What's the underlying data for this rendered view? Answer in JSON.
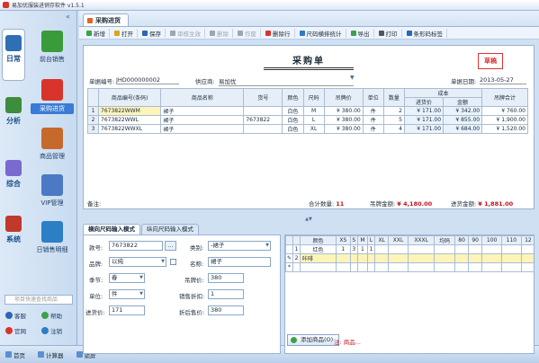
{
  "app": {
    "title": "易加优服装进销存软件 v1.5.1"
  },
  "sidebar": {
    "collapse_label": "«",
    "categories": [
      {
        "label": "日常",
        "color": "#2f6fb3"
      },
      {
        "label": "分析",
        "color": "#3c8d3c"
      },
      {
        "label": "综合",
        "color": "#7a6ad0"
      },
      {
        "label": "系统",
        "color": "#c0392b"
      }
    ],
    "modules": [
      {
        "label": "前台销售",
        "color": "#3a9b3a"
      },
      {
        "label": "采购进货",
        "color": "#d9342b"
      },
      {
        "label": "商品管理",
        "color": "#c56a2c"
      },
      {
        "label": "VIP管理",
        "color": "#4b79c4"
      },
      {
        "label": "日销售明细",
        "color": "#2c7ec5"
      }
    ],
    "search_placeholder": "项目快速查找商品",
    "links": [
      {
        "label": "客服",
        "color": "#2c66b8"
      },
      {
        "label": "帮助",
        "color": "#3aa24a"
      },
      {
        "label": "官网",
        "color": "#d9342b"
      },
      {
        "label": "注销",
        "color": "#2c7ec5"
      }
    ]
  },
  "statusbar": {
    "items": [
      "首页",
      "计算器",
      "锁屏"
    ]
  },
  "tab": {
    "label": "采购进货"
  },
  "toolbar": {
    "items": [
      {
        "label": "新增",
        "color": "#3aa24a",
        "dim": false
      },
      {
        "label": "打开",
        "color": "#e0a21c",
        "dim": false
      },
      {
        "label": "保存",
        "color": "#2c66b8",
        "dim": false
      },
      {
        "label": "审核生效",
        "color": "#9aa6b4",
        "dim": true
      },
      {
        "label": "删除",
        "color": "#9aa6b4",
        "dim": true
      },
      {
        "label": "作废",
        "color": "#9aa6b4",
        "dim": true
      },
      {
        "label": "删除行",
        "color": "#d9342b",
        "dim": false
      },
      {
        "label": "尺码横排统计",
        "color": "#2c7ec5",
        "dim": false
      },
      {
        "label": "导出",
        "color": "#3aa24a",
        "dim": false
      },
      {
        "label": "打印",
        "color": "#555555",
        "dim": false
      },
      {
        "label": "条形码标签",
        "color": "#2c66b8",
        "dim": false
      }
    ]
  },
  "form": {
    "title": "采购单",
    "stamp": "草稿",
    "order_no_label": "单据编号:",
    "order_no": "JHD000000002",
    "supplier_label": "供应商:",
    "supplier": "易加优",
    "date_label": "单据日期:",
    "date": "2013-05-27",
    "columns": [
      "商品编号(条码)",
      "商品名称",
      "货号",
      "颜色",
      "尺码",
      "吊牌价",
      "单位",
      "数量",
      "进货价",
      "金额",
      "吊牌合计"
    ],
    "cost_group_label": "成本",
    "rows": [
      {
        "idx": "1",
        "code": "7673822WWM",
        "name": "裙子",
        "item_no": "",
        "color": "白色",
        "size": "M",
        "tag_price": "¥ 380.00",
        "unit": "件",
        "qty": "2",
        "cost": "¥ 171.00",
        "amount": "¥ 342.00",
        "tag_total": "¥ 760.00"
      },
      {
        "idx": "2",
        "code": "7673822WWL",
        "name": "裙子",
        "item_no": "7673822",
        "color": "白色",
        "size": "L",
        "tag_price": "¥ 380.00",
        "unit": "件",
        "qty": "5",
        "cost": "¥ 171.00",
        "amount": "¥ 855.00",
        "tag_total": "¥ 1,900.00"
      },
      {
        "idx": "3",
        "code": "7673822WWXL",
        "name": "裙子",
        "item_no": "",
        "color": "白色",
        "size": "XL",
        "tag_price": "¥ 380.00",
        "unit": "件",
        "qty": "4",
        "cost": "¥ 171.00",
        "amount": "¥ 684.00",
        "tag_total": "¥ 1,520.00"
      }
    ],
    "remark_label": "备注:",
    "qty_total_label": "合计数量:",
    "qty_total": "11",
    "tag_total_label": "吊牌金额:",
    "tag_total": "¥ 4,180.00",
    "cost_total_label": "进货金额:",
    "cost_total": "¥ 1,881.00"
  },
  "entry": {
    "tabs": [
      "横向尺码输入模式",
      "纵向尺码输入模式"
    ],
    "fields": {
      "item_no_label": "款号:",
      "item_no": "7673822",
      "category_label": "类别:",
      "category": "-裙子",
      "brand_label": "品牌:",
      "brand": "以纯",
      "name_label": "名称:",
      "name": "裙子",
      "season_label": "季节:",
      "season": "春",
      "tag_price_label": "吊牌价:",
      "tag_price": "380",
      "unit_label": "单位:",
      "unit": "件",
      "discount_label": "销售折扣:",
      "discount": "1",
      "cost_label": "进货价:",
      "cost": "171",
      "after_discount_label": "折后售价:",
      "after_discount": "380"
    },
    "size_headers": [
      "颜色",
      "XS",
      "S",
      "M",
      "L",
      "XL",
      "XXL",
      "XXXL",
      "均码",
      "80",
      "90",
      "100",
      "110",
      "12"
    ],
    "size_rows": [
      {
        "marker": "",
        "idx": "1",
        "cells": [
          "红色",
          "1",
          "3",
          "1",
          "1",
          "",
          "",
          "",
          "",
          "",
          "",
          "",
          "",
          ""
        ]
      },
      {
        "marker": "✎",
        "idx": "2",
        "cells": [
          "咔啡",
          "",
          "",
          "",
          "",
          "",
          "",
          "",
          "",
          "",
          "",
          "",
          "",
          ""
        ]
      },
      {
        "marker": "*",
        "idx": "",
        "cells": [
          "",
          "",
          "",
          "",
          "",
          "",
          "",
          "",
          "",
          "",
          "",
          "",
          "",
          ""
        ]
      }
    ],
    "add_button": "添加商品(O)",
    "note": "注: 商品..."
  }
}
